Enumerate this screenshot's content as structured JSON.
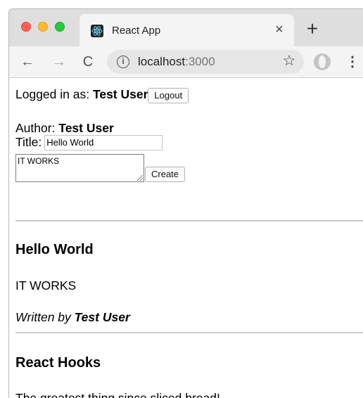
{
  "browser": {
    "tab": {
      "title": "React App",
      "close_glyph": "×",
      "favicon": "react-logo-icon"
    },
    "new_tab_glyph": "+",
    "nav": {
      "back_glyph": "←",
      "forward_glyph": "→",
      "reload_glyph": "C"
    },
    "address": {
      "host": "localhost",
      "port": ":3000"
    },
    "bookmark_glyph": "☆",
    "menu_glyph": "⋮",
    "traffic_lights": {
      "close": "#fe5f57",
      "minimize": "#febc2e",
      "maximize": "#28c840"
    }
  },
  "user_bar": {
    "prefix": "Logged in as: ",
    "username": "Test User",
    "logout_label": "Logout"
  },
  "create_post": {
    "author_prefix": "Author: ",
    "author_name": "Test User",
    "title_label": "Title:",
    "title_value": "Hello World",
    "content_value": "IT WORKS",
    "create_label": "Create"
  },
  "posts": [
    {
      "title": "Hello World",
      "content": "IT WORKS",
      "byline_prefix": "Written by ",
      "author": "Test User"
    },
    {
      "title": "React Hooks",
      "content": "The greatest thing since sliced bread!"
    }
  ]
}
